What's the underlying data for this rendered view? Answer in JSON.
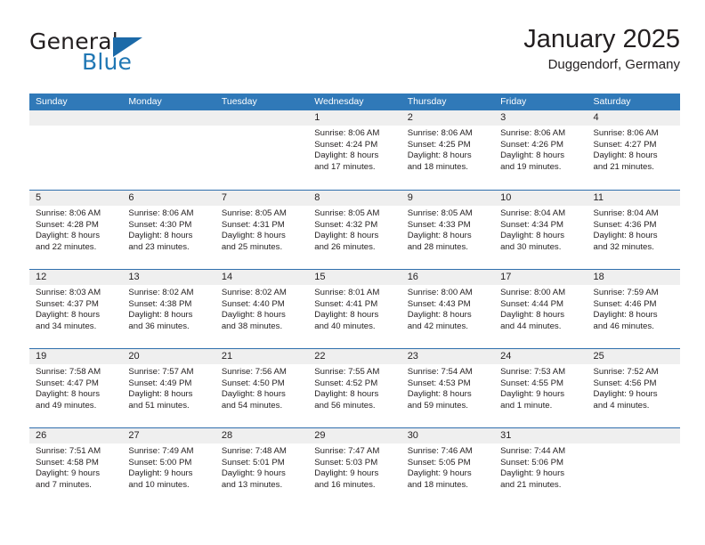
{
  "brand": {
    "name_top": "General",
    "name_bottom": "Blue",
    "accent_color": "#2077b4",
    "triangle_color": "#1c6aa8"
  },
  "header": {
    "title": "January 2025",
    "location": "Duggendorf, Germany"
  },
  "theme": {
    "header_row_bg": "#3079b8",
    "row_divider": "#2f6fad",
    "day_band_bg": "#efefef",
    "text_color": "#231f20"
  },
  "weekdays": [
    "Sunday",
    "Monday",
    "Tuesday",
    "Wednesday",
    "Thursday",
    "Friday",
    "Saturday"
  ],
  "weeks": [
    [
      {
        "day": "",
        "lines": []
      },
      {
        "day": "",
        "lines": []
      },
      {
        "day": "",
        "lines": []
      },
      {
        "day": "1",
        "lines": [
          "Sunrise: 8:06 AM",
          "Sunset: 4:24 PM",
          "Daylight: 8 hours",
          "and 17 minutes."
        ]
      },
      {
        "day": "2",
        "lines": [
          "Sunrise: 8:06 AM",
          "Sunset: 4:25 PM",
          "Daylight: 8 hours",
          "and 18 minutes."
        ]
      },
      {
        "day": "3",
        "lines": [
          "Sunrise: 8:06 AM",
          "Sunset: 4:26 PM",
          "Daylight: 8 hours",
          "and 19 minutes."
        ]
      },
      {
        "day": "4",
        "lines": [
          "Sunrise: 8:06 AM",
          "Sunset: 4:27 PM",
          "Daylight: 8 hours",
          "and 21 minutes."
        ]
      }
    ],
    [
      {
        "day": "5",
        "lines": [
          "Sunrise: 8:06 AM",
          "Sunset: 4:28 PM",
          "Daylight: 8 hours",
          "and 22 minutes."
        ]
      },
      {
        "day": "6",
        "lines": [
          "Sunrise: 8:06 AM",
          "Sunset: 4:30 PM",
          "Daylight: 8 hours",
          "and 23 minutes."
        ]
      },
      {
        "day": "7",
        "lines": [
          "Sunrise: 8:05 AM",
          "Sunset: 4:31 PM",
          "Daylight: 8 hours",
          "and 25 minutes."
        ]
      },
      {
        "day": "8",
        "lines": [
          "Sunrise: 8:05 AM",
          "Sunset: 4:32 PM",
          "Daylight: 8 hours",
          "and 26 minutes."
        ]
      },
      {
        "day": "9",
        "lines": [
          "Sunrise: 8:05 AM",
          "Sunset: 4:33 PM",
          "Daylight: 8 hours",
          "and 28 minutes."
        ]
      },
      {
        "day": "10",
        "lines": [
          "Sunrise: 8:04 AM",
          "Sunset: 4:34 PM",
          "Daylight: 8 hours",
          "and 30 minutes."
        ]
      },
      {
        "day": "11",
        "lines": [
          "Sunrise: 8:04 AM",
          "Sunset: 4:36 PM",
          "Daylight: 8 hours",
          "and 32 minutes."
        ]
      }
    ],
    [
      {
        "day": "12",
        "lines": [
          "Sunrise: 8:03 AM",
          "Sunset: 4:37 PM",
          "Daylight: 8 hours",
          "and 34 minutes."
        ]
      },
      {
        "day": "13",
        "lines": [
          "Sunrise: 8:02 AM",
          "Sunset: 4:38 PM",
          "Daylight: 8 hours",
          "and 36 minutes."
        ]
      },
      {
        "day": "14",
        "lines": [
          "Sunrise: 8:02 AM",
          "Sunset: 4:40 PM",
          "Daylight: 8 hours",
          "and 38 minutes."
        ]
      },
      {
        "day": "15",
        "lines": [
          "Sunrise: 8:01 AM",
          "Sunset: 4:41 PM",
          "Daylight: 8 hours",
          "and 40 minutes."
        ]
      },
      {
        "day": "16",
        "lines": [
          "Sunrise: 8:00 AM",
          "Sunset: 4:43 PM",
          "Daylight: 8 hours",
          "and 42 minutes."
        ]
      },
      {
        "day": "17",
        "lines": [
          "Sunrise: 8:00 AM",
          "Sunset: 4:44 PM",
          "Daylight: 8 hours",
          "and 44 minutes."
        ]
      },
      {
        "day": "18",
        "lines": [
          "Sunrise: 7:59 AM",
          "Sunset: 4:46 PM",
          "Daylight: 8 hours",
          "and 46 minutes."
        ]
      }
    ],
    [
      {
        "day": "19",
        "lines": [
          "Sunrise: 7:58 AM",
          "Sunset: 4:47 PM",
          "Daylight: 8 hours",
          "and 49 minutes."
        ]
      },
      {
        "day": "20",
        "lines": [
          "Sunrise: 7:57 AM",
          "Sunset: 4:49 PM",
          "Daylight: 8 hours",
          "and 51 minutes."
        ]
      },
      {
        "day": "21",
        "lines": [
          "Sunrise: 7:56 AM",
          "Sunset: 4:50 PM",
          "Daylight: 8 hours",
          "and 54 minutes."
        ]
      },
      {
        "day": "22",
        "lines": [
          "Sunrise: 7:55 AM",
          "Sunset: 4:52 PM",
          "Daylight: 8 hours",
          "and 56 minutes."
        ]
      },
      {
        "day": "23",
        "lines": [
          "Sunrise: 7:54 AM",
          "Sunset: 4:53 PM",
          "Daylight: 8 hours",
          "and 59 minutes."
        ]
      },
      {
        "day": "24",
        "lines": [
          "Sunrise: 7:53 AM",
          "Sunset: 4:55 PM",
          "Daylight: 9 hours",
          "and 1 minute."
        ]
      },
      {
        "day": "25",
        "lines": [
          "Sunrise: 7:52 AM",
          "Sunset: 4:56 PM",
          "Daylight: 9 hours",
          "and 4 minutes."
        ]
      }
    ],
    [
      {
        "day": "26",
        "lines": [
          "Sunrise: 7:51 AM",
          "Sunset: 4:58 PM",
          "Daylight: 9 hours",
          "and 7 minutes."
        ]
      },
      {
        "day": "27",
        "lines": [
          "Sunrise: 7:49 AM",
          "Sunset: 5:00 PM",
          "Daylight: 9 hours",
          "and 10 minutes."
        ]
      },
      {
        "day": "28",
        "lines": [
          "Sunrise: 7:48 AM",
          "Sunset: 5:01 PM",
          "Daylight: 9 hours",
          "and 13 minutes."
        ]
      },
      {
        "day": "29",
        "lines": [
          "Sunrise: 7:47 AM",
          "Sunset: 5:03 PM",
          "Daylight: 9 hours",
          "and 16 minutes."
        ]
      },
      {
        "day": "30",
        "lines": [
          "Sunrise: 7:46 AM",
          "Sunset: 5:05 PM",
          "Daylight: 9 hours",
          "and 18 minutes."
        ]
      },
      {
        "day": "31",
        "lines": [
          "Sunrise: 7:44 AM",
          "Sunset: 5:06 PM",
          "Daylight: 9 hours",
          "and 21 minutes."
        ]
      },
      {
        "day": "",
        "lines": []
      }
    ]
  ]
}
